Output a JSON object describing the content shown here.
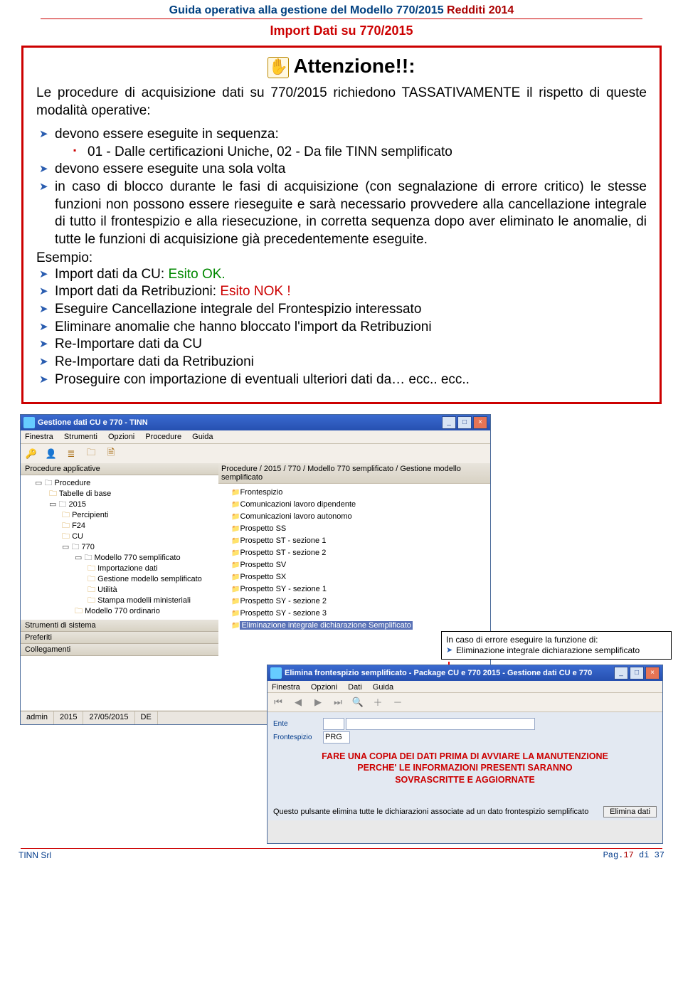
{
  "header": {
    "title_blue": "Guida operativa alla gestione del Modello 770/2015",
    "title_red": "Redditi 2014",
    "section": "Import Dati su 770/2015"
  },
  "box": {
    "attenzione": "Attenzione!!:",
    "intro": "Le procedure di acquisizione dati su 770/2015 richiedono TASSATIVAMENTE il rispetto di queste modalità operative:",
    "b1": "devono essere eseguite in sequenza:",
    "b1_sub": "01 - Dalle certificazioni Uniche,  02 - Da file TINN semplificato",
    "b2": "devono essere eseguite una sola volta",
    "b3": "in caso di blocco durante le fasi di acquisizione (con segnalazione di errore critico) le stesse funzioni non possono essere rieseguite e sarà necessario provvedere alla cancellazione integrale di tutto il frontespizio e alla riesecuzione, in corretta sequenza dopo aver eliminato le anomalie, di tutte le funzioni di acquisizione già precedentemente eseguite.",
    "esempio": "Esempio:",
    "e1a": "Import dati da CU: ",
    "e1b": "Esito OK.",
    "e2a": "Import dati da Retribuzioni: ",
    "e2b": "Esito NOK !",
    "e3": "Eseguire Cancellazione integrale del Frontespizio interessato",
    "e4": "Eliminare anomalie che hanno bloccato l'import da Retribuzioni",
    "e5": "Re-Importare dati da CU",
    "e6": "Re-Importare dati da Retribuzioni",
    "e7": "Proseguire con importazione di eventuali ulteriori dati da… ecc.. ecc.."
  },
  "win1": {
    "title": "Gestione dati CU e 770 - TINN",
    "menu": [
      "Finestra",
      "Strumenti",
      "Opzioni",
      "Procedure",
      "Guida"
    ],
    "pane_hdr": "Procedure applicative",
    "tree": {
      "n0": "Procedure",
      "n1": "Tabelle di base",
      "n2": "2015",
      "n3": "Percipienti",
      "n4": "F24",
      "n5": "CU",
      "n6": "770",
      "n7": "Modello 770 semplificato",
      "n8": "Importazione dati",
      "n9": "Gestione modello semplificato",
      "n10": "Utilità",
      "n11": "Stampa modelli ministeriali",
      "n12": "Modello 770 ordinario"
    },
    "tree_sections": {
      "s1": "Strumenti di sistema",
      "s2": "Preferiti",
      "s3": "Collegamenti"
    },
    "breadcrumb": "Procedure / 2015 / 770 / Modello 770 semplificato / Gestione modello semplificato",
    "rlist": {
      "r0": "Frontespizio",
      "r1": "Comunicazioni lavoro dipendente",
      "r2": "Comunicazioni lavoro autonomo",
      "r3": "Prospetto SS",
      "r4": "Prospetto ST - sezione 1",
      "r5": "Prospetto ST - sezione 2",
      "r6": "Prospetto SV",
      "r7": "Prospetto SX",
      "r8": "Prospetto SY - sezione 1",
      "r9": "Prospetto SY - sezione 2",
      "r10": "Prospetto SY - sezione 3",
      "r11": "Eliminazione integrale dichiarazione Semplificato"
    },
    "status": {
      "s0": "admin",
      "s1": "2015",
      "s2": "27/05/2015",
      "s3": "DE"
    }
  },
  "callout": {
    "line1": "In caso di errore eseguire la funzione di:",
    "line2": "Eliminazione integrale dichiarazione semplificato"
  },
  "win2": {
    "title": "Elimina frontespizio semplificato - Package CU e 770 2015 - Gestione dati CU e 770",
    "menu": [
      "Finestra",
      "Opzioni",
      "Dati",
      "Guida"
    ],
    "lbl_ente": "Ente",
    "lbl_front": "Frontespizio",
    "val_front": "PRG",
    "warn1": "FARE UNA COPIA DEI DATI PRIMA DI AVVIARE LA MANUTENZIONE",
    "warn2": "PERCHE' LE INFORMAZIONI PRESENTI SARANNO",
    "warn3": "SOVRASCRITTE E AGGIORNATE",
    "elim_desc": "Questo pulsante elimina tutte le dichiarazioni associate ad un dato frontespizio semplificato",
    "elim_btn": "Elimina dati"
  },
  "footer": {
    "left": "TINN Srl",
    "right_a": "Pag.",
    "right_n": "17",
    "right_b": " di 37"
  }
}
